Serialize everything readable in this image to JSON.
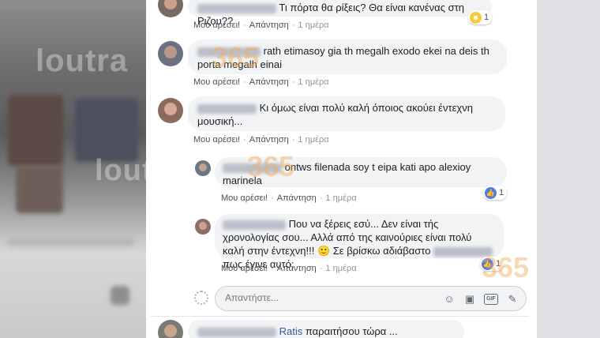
{
  "comments": [
    {
      "text": "Τι πόρτα θα ρίξεις? Θα είναι κανένας στη Ριζου??",
      "like": "Μου αρέσει!",
      "reply": "Απάντηση",
      "time": "1 ημέρα",
      "reaction": {
        "type": "haha",
        "count": "1"
      }
    },
    {
      "text": "rath etimasoy gia th megalh exodo ekei na deis th porta megalh einai",
      "like": "Μου αρέσει!",
      "reply": "Απάντηση",
      "time": "1 ημέρα"
    },
    {
      "text": "Κι όμως είναι πολύ καλή όποιος ακούει έντεχνη μουσική...",
      "like": "Μου αρέσει!",
      "reply": "Απάντηση",
      "time": "1 ημέρα"
    }
  ],
  "replies": [
    {
      "text": "ontws filenada soy t eipa kati apo alexioy marinela",
      "like": "Μου αρέσει!",
      "reply": "Απάντηση",
      "time": "1 ημέρα",
      "reaction": {
        "type": "like",
        "count": "1"
      }
    },
    {
      "text_part1": "Που να ξέρεις εσύ... Δεν είναι τής χρονολογίας σου... Αλλά από της καινούριες είναι πολύ καλή στην έντεχνη!!!",
      "text_part2": "🙂 Σε βρίσκω αδιάβαστο",
      "text_part3": "πως έγινε αυτό;",
      "like": "Μου αρέσει!",
      "reply": "Απάντηση",
      "time": "1 ημέρα",
      "reaction": {
        "type": "like",
        "count": "1"
      }
    }
  ],
  "reply_input": {
    "placeholder": "Απαντήστε..."
  },
  "last_comment": {
    "name": "Ratis",
    "text": "παραιτήσου τώρα ... προλαβαίνεις"
  },
  "watermarks": {
    "brand": "loutra",
    "number": "365"
  },
  "colors": {
    "like_blue": "#4a7bf0",
    "haha_yellow": "#f7c93b",
    "link_blue": "#385898"
  }
}
